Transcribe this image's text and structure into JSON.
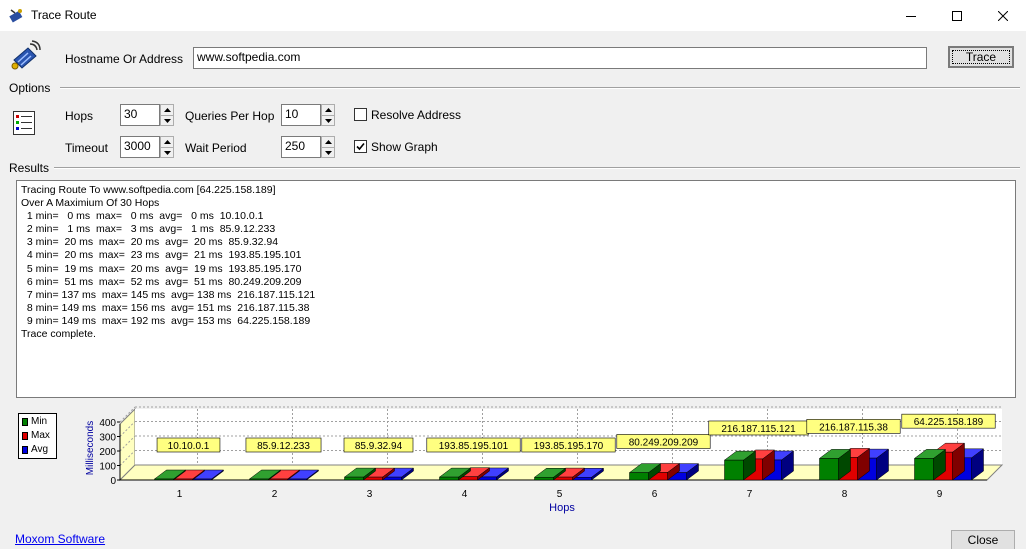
{
  "window": {
    "title": "Trace Route",
    "app_icon": "trace-route-icon"
  },
  "controls": [
    "minimize-icon",
    "maximize-icon",
    "close-icon"
  ],
  "host": {
    "label": "Hostname Or Address",
    "value": "www.softpedia.com",
    "button": "Trace"
  },
  "options": {
    "section_label": "Options",
    "hops_label": "Hops",
    "hops_value": "30",
    "queries_label": "Queries Per Hop",
    "queries_value": "10",
    "timeout_label": "Timeout",
    "timeout_value": "3000",
    "wait_label": "Wait Period",
    "wait_value": "250",
    "resolve_label": "Resolve Address",
    "resolve_checked": false,
    "show_graph_label": "Show Graph",
    "show_graph_checked": true
  },
  "results": {
    "section_label": "Results",
    "lines": [
      "Tracing Route To www.softpedia.com [64.225.158.189]",
      "Over A Maximium Of 30 Hops",
      "  1 min=   0 ms  max=   0 ms  avg=   0 ms  10.10.0.1",
      "  2 min=   1 ms  max=   3 ms  avg=   1 ms  85.9.12.233",
      "  3 min=  20 ms  max=  20 ms  avg=  20 ms  85.9.32.94",
      "  4 min=  20 ms  max=  23 ms  avg=  21 ms  193.85.195.101",
      "  5 min=  19 ms  max=  20 ms  avg=  19 ms  193.85.195.170",
      "  6 min=  51 ms  max=  52 ms  avg=  51 ms  80.249.209.209",
      "  7 min= 137 ms  max= 145 ms  avg= 138 ms  216.187.115.121",
      "  8 min= 149 ms  max= 156 ms  avg= 151 ms  216.187.115.38",
      "  9 min= 149 ms  max= 192 ms  avg= 153 ms  64.225.158.189",
      "Trace complete."
    ]
  },
  "graph": {
    "legend": [
      "Min",
      "Max",
      "Avg"
    ],
    "colors": {
      "min": "#008000",
      "max": "#e00000",
      "avg": "#0000e0"
    },
    "ylabel": "Milliseconds",
    "xlabel": "Hops",
    "yticks": [
      "400",
      "300",
      "200",
      "100",
      "0"
    ]
  },
  "chart_data": {
    "type": "bar",
    "categories": [
      "1",
      "2",
      "3",
      "4",
      "5",
      "6",
      "7",
      "8",
      "9"
    ],
    "hop_labels": [
      "10.10.0.1",
      "85.9.12.233",
      "85.9.32.94",
      "193.85.195.101",
      "193.85.195.170",
      "80.249.209.209",
      "216.187.115.121",
      "216.187.115.38",
      "64.225.158.189"
    ],
    "series": [
      {
        "name": "Min",
        "values": [
          0,
          1,
          20,
          20,
          19,
          51,
          137,
          149,
          149
        ]
      },
      {
        "name": "Max",
        "values": [
          0,
          3,
          20,
          23,
          20,
          52,
          145,
          156,
          192
        ]
      },
      {
        "name": "Avg",
        "values": [
          0,
          1,
          20,
          21,
          19,
          51,
          138,
          151,
          153
        ]
      }
    ],
    "xlabel": "Hops",
    "ylabel": "Milliseconds",
    "ylim": [
      0,
      400
    ],
    "legend_position": "left"
  },
  "footer": {
    "link": "Moxom Software",
    "close": "Close"
  }
}
